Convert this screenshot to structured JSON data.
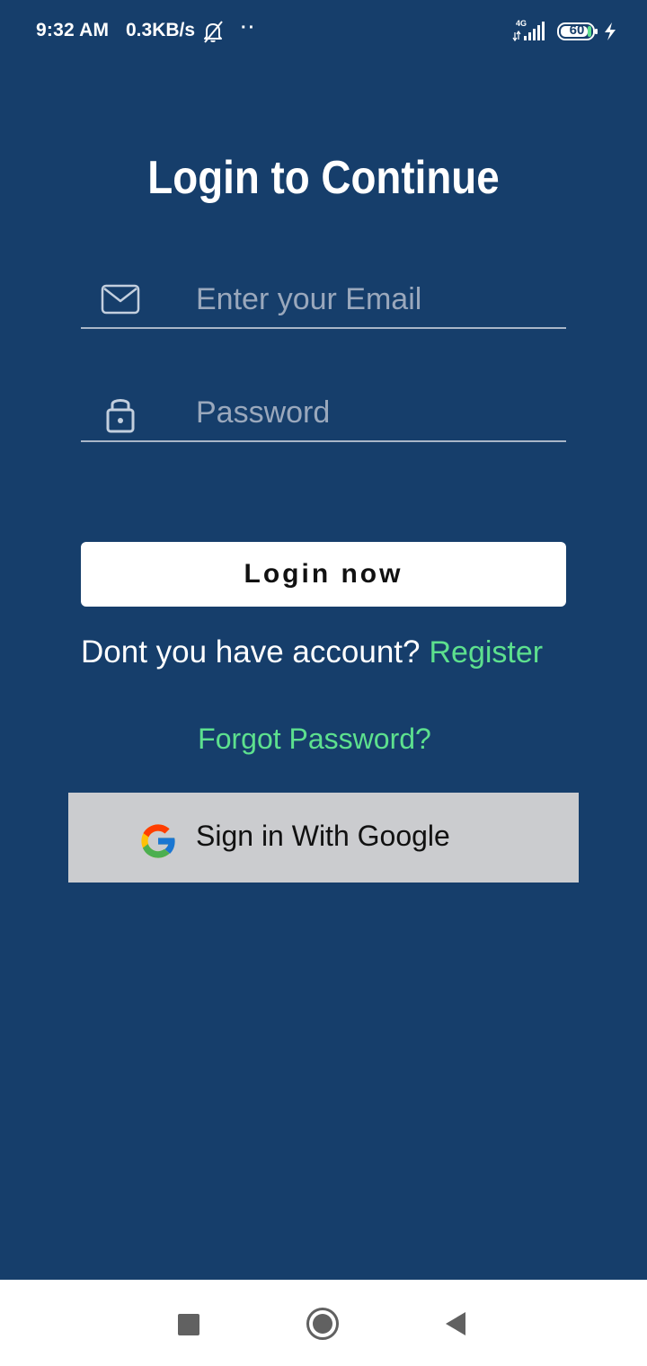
{
  "status_bar": {
    "time": "9:32 AM",
    "speed": "0.3KB/s",
    "more": "··",
    "network": "4G",
    "battery": "60",
    "icons": [
      "bell-off-icon",
      "signal-icon",
      "battery-icon",
      "charging-icon"
    ]
  },
  "page": {
    "title": "Login to Continue",
    "background_color": "#163e6b",
    "accent_color": "#5de08e"
  },
  "form": {
    "email": {
      "placeholder": "Enter your Email",
      "value": "",
      "icon": "mail-icon"
    },
    "password": {
      "placeholder": "Password",
      "value": "",
      "icon": "lock-icon"
    },
    "login_label": "Login now"
  },
  "register": {
    "prompt": "Dont you have account?",
    "link": "Register"
  },
  "forgot_password": "Forgot Password?",
  "google": {
    "label": "Sign in With Google",
    "icon": "google-icon"
  },
  "nav_bar": {
    "buttons": [
      "recents-icon",
      "home-icon",
      "back-icon"
    ]
  }
}
